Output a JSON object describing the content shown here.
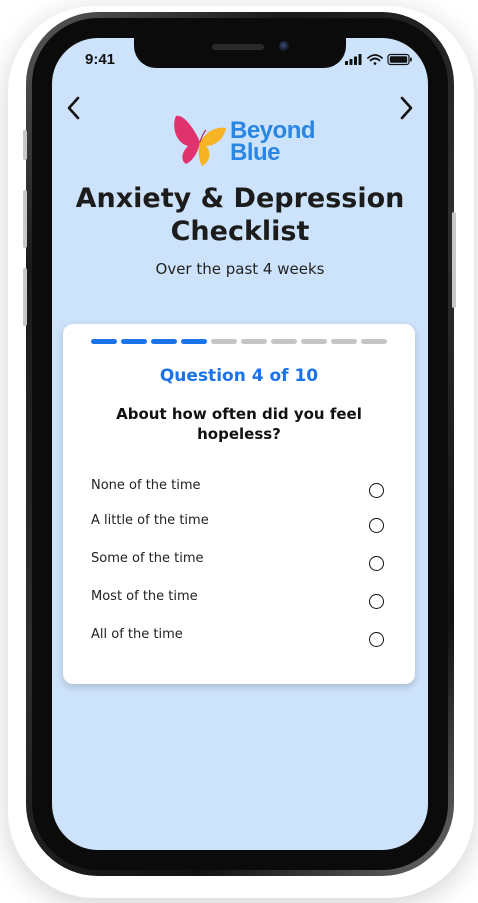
{
  "status_bar": {
    "time": "9:41"
  },
  "logo": {
    "line1": "Beyond",
    "line2": "Blue"
  },
  "header": {
    "title": "Anxiety & Depression Checklist",
    "subtitle": "Over the past 4 weeks"
  },
  "progress": {
    "current": 4,
    "total": 10
  },
  "question": {
    "number_label": "Question 4 of 10",
    "text": "About how often did you feel hopeless?"
  },
  "options": [
    {
      "label": "None of the time"
    },
    {
      "label": "A little of the time"
    },
    {
      "label": "Some of the time"
    },
    {
      "label": "Most of the time"
    },
    {
      "label": "All of the time"
    }
  ],
  "colors": {
    "screen_bg": "#cde3fb",
    "accent": "#1a73e8",
    "logo_blue": "#2a86e2",
    "progress_inactive": "#c5c5c5"
  },
  "icons": {
    "back": "chevron-left-icon",
    "forward": "chevron-right-icon",
    "signal": "cellular-signal-icon",
    "wifi": "wifi-icon",
    "battery": "battery-icon"
  }
}
